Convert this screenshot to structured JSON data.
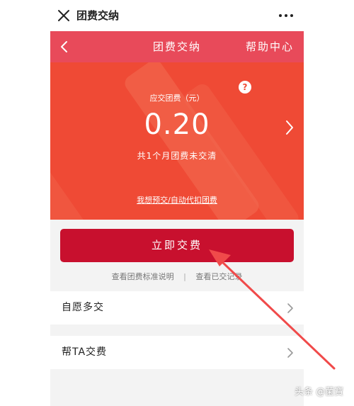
{
  "window": {
    "title": "团费交纳"
  },
  "hero": {
    "header_title": "团费交纳",
    "help_label": "帮助中心",
    "due_label": "应交团费（元）",
    "amount": "0.20",
    "months_note": "共1个月团费未交清",
    "autopay_link": "我想预交/自动代扣团费",
    "question_mark": "?"
  },
  "actions": {
    "pay_button": "立即交费",
    "standards_link": "查看团费标准说明",
    "separator": "|",
    "records_link": "查看已交记录"
  },
  "rows": [
    {
      "label": "自愿多交"
    },
    {
      "label": "帮TA交费"
    }
  ],
  "watermark": "头条 @菌寶",
  "colors": {
    "hero_bg": "#ef4a35",
    "header_bg": "#e84a5a",
    "button_bg": "#c8102e",
    "annotation_arrow": "#f04a4a"
  },
  "icons": {
    "close": "close-icon",
    "more": "more-icon",
    "back": "back-chevron-icon",
    "help": "question-icon",
    "next": "chevron-right-icon"
  }
}
